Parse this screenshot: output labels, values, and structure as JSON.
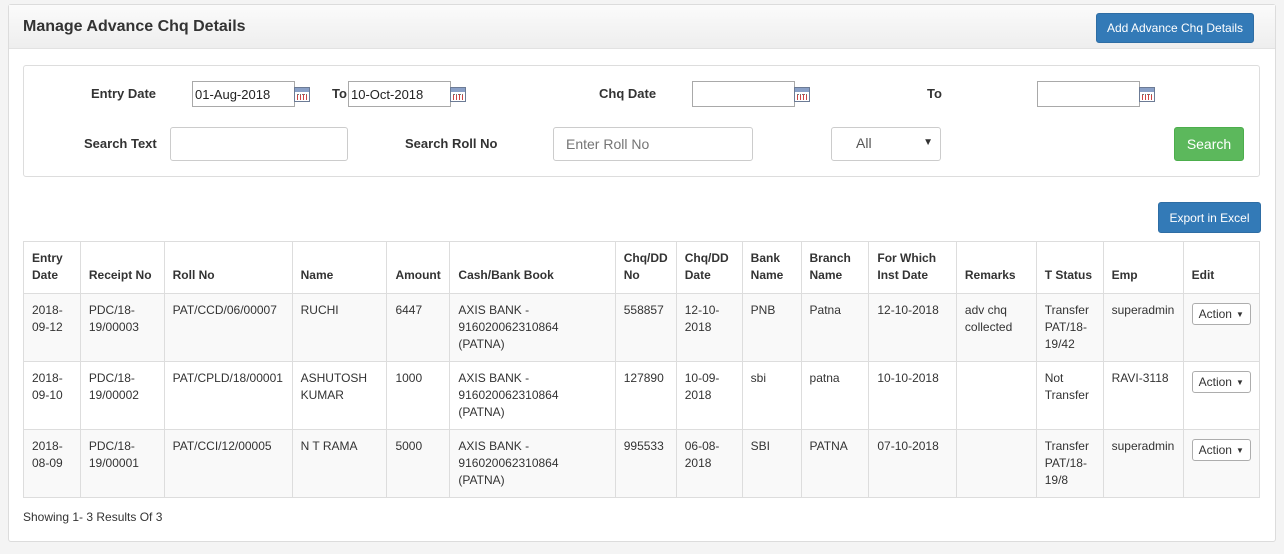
{
  "header": {
    "title": "Manage Advance Chq Details",
    "add_button": "Add Advance Chq Details"
  },
  "filters": {
    "entry_date_label": "Entry Date",
    "entry_from": "01-Aug-2018",
    "to_label": "To",
    "entry_to": "10-Oct-2018",
    "chq_date_label": "Chq Date",
    "chq_from": "",
    "chq_to_label": "To",
    "chq_to": "",
    "search_text_label": "Search Text",
    "search_text": "",
    "roll_label": "Search Roll No",
    "roll_placeholder": "Enter Roll No",
    "status_select": "All",
    "search_button": "Search"
  },
  "export_button": "Export in Excel",
  "table": {
    "headers": {
      "entry_date": "Entry Date",
      "receipt_no": "Receipt No",
      "roll_no": "Roll No",
      "name": "Name",
      "amount": "Amount",
      "cash_bank": "Cash/Bank Book",
      "chq_no": "Chq/DD No",
      "chq_date": "Chq/DD Date",
      "bank": "Bank Name",
      "branch": "Branch Name",
      "inst_date": "For Which Inst Date",
      "remarks": "Remarks",
      "t_status": "T Status",
      "emp": "Emp",
      "edit": "Edit"
    },
    "rows": [
      {
        "entry_date": "2018-09-12",
        "receipt_no": "PDC/18-19/00003",
        "roll_no": "PAT/CCD/06/00007",
        "name": "RUCHI",
        "amount": "6447",
        "cash_bank": "AXIS BANK - 916020062310864 (PATNA)",
        "chq_no": "558857",
        "chq_date": "12-10-2018",
        "bank": "PNB",
        "branch": "Patna",
        "inst_date": "12-10-2018",
        "remarks": "adv chq collected",
        "t_status": "Transfer PAT/18-19/42",
        "emp": "superadmin",
        "action": "Action"
      },
      {
        "entry_date": "2018-09-10",
        "receipt_no": "PDC/18-19/00002",
        "roll_no": "PAT/CPLD/18/00001",
        "name": "ASHUTOSH KUMAR",
        "amount": "1000",
        "cash_bank": "AXIS BANK - 916020062310864 (PATNA)",
        "chq_no": "127890",
        "chq_date": "10-09-2018",
        "bank": "sbi",
        "branch": "patna",
        "inst_date": "10-10-2018",
        "remarks": "",
        "t_status": "Not Transfer",
        "emp": "RAVI-3118",
        "action": "Action"
      },
      {
        "entry_date": "2018-08-09",
        "receipt_no": "PDC/18-19/00001",
        "roll_no": "PAT/CCI/12/00005",
        "name": "N T RAMA",
        "amount": "5000",
        "cash_bank": "AXIS BANK - 916020062310864 (PATNA)",
        "chq_no": "995533",
        "chq_date": "06-08-2018",
        "bank": "SBI",
        "branch": "PATNA",
        "inst_date": "07-10-2018",
        "remarks": "",
        "t_status": "Transfer PAT/18-19/8",
        "emp": "superadmin",
        "action": "Action"
      }
    ]
  },
  "footer": "Showing 1- 3 Results Of 3"
}
